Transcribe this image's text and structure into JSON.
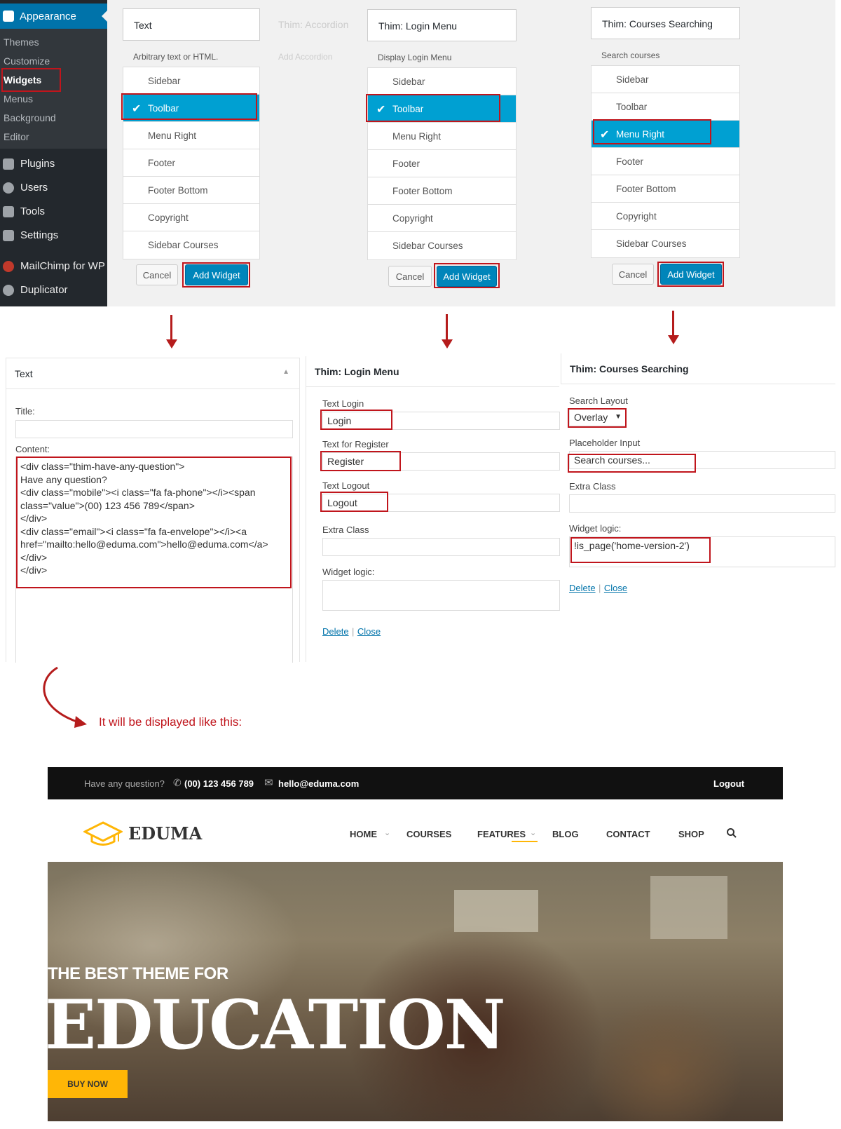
{
  "sidebar": {
    "appearance": "Appearance",
    "submenu": [
      "Themes",
      "Customize",
      "Widgets",
      "Menus",
      "Background",
      "Editor"
    ],
    "items": [
      "Plugins",
      "Users",
      "Tools",
      "Settings",
      "MailChimp for WP",
      "Duplicator"
    ]
  },
  "widget_lists": {
    "text": {
      "title": "Text",
      "description": "Arbitrary text or HTML."
    },
    "accordion": {
      "title": "Thim: Accordion",
      "description": "Add Accordion"
    },
    "login": {
      "title": "Thim: Login Menu",
      "description": "Display Login Menu"
    },
    "courses": {
      "title": "Thim: Courses Searching",
      "description": "Search courses"
    },
    "sidebars": [
      "Sidebar",
      "Toolbar",
      "Menu Right",
      "Footer",
      "Footer Bottom",
      "Copyright",
      "Sidebar Courses"
    ],
    "selected": {
      "text": "Toolbar",
      "login": "Toolbar",
      "courses": "Menu Right"
    },
    "cancel": "Cancel",
    "add_widget": "Add Widget"
  },
  "text_form": {
    "header": "Text",
    "title_label": "Title:",
    "content_label": "Content:",
    "content_lines": [
      "<div class=\"thim-have-any-question\">",
      "Have any question?",
      "<div class=\"mobile\"><i class=\"fa fa-phone\"></i><span",
      "class=\"value\">(00) 123 456 789</span>",
      "</div>",
      "<div class=\"email\"><i class=\"fa fa-envelope\"></i><a",
      "href=\"mailto:hello@eduma.com\">hello@eduma.com</a>",
      "</div>",
      "</div>"
    ]
  },
  "login_form": {
    "header": "Thim: Login Menu",
    "text_login_label": "Text Login",
    "text_login": "Login",
    "text_register_label": "Text for Register",
    "text_register": "Register",
    "text_logout_label": "Text Logout",
    "text_logout": "Logout",
    "extra_class_label": "Extra Class",
    "widget_logic_label": "Widget logic:",
    "delete": "Delete",
    "close": "Close",
    "separator": "|"
  },
  "courses_form": {
    "header": "Thim: Courses Searching",
    "search_layout_label": "Search Layout",
    "search_layout": "Overlay",
    "placeholder_label": "Placeholder Input",
    "placeholder": "Search courses...",
    "extra_class_label": "Extra Class",
    "widget_logic_label": "Widget logic:",
    "widget_logic": "!is_page('home-version-2')",
    "delete": "Delete",
    "close": "Close",
    "separator": "|"
  },
  "caption": "It will be displayed like this:",
  "preview": {
    "topbar": {
      "question": "Have any question?",
      "phone": "(00) 123 456 789",
      "email": "hello@eduma.com",
      "logout": "Logout"
    },
    "logo": "EDUMA",
    "nav": [
      "HOME",
      "COURSES",
      "FEATURES",
      "BLOG",
      "CONTACT",
      "SHOP"
    ],
    "hero": {
      "subtitle": "THE BEST THEME FOR",
      "title": "EDUCATION",
      "button": "BUY NOW"
    }
  },
  "colors": {
    "wp_sidebar": "#23282d",
    "wp_blue": "#0073aa",
    "selection_blue": "#00a0d2",
    "highlight_red": "#c0151c",
    "eduma_yellow": "#ffb606"
  }
}
